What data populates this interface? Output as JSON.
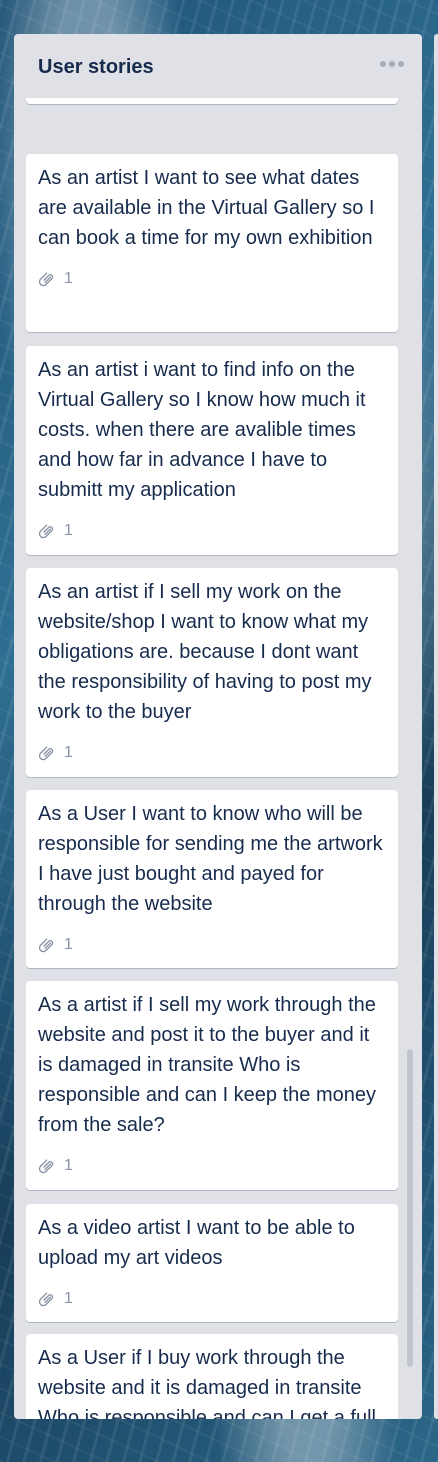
{
  "list": {
    "title": "User stories",
    "more_icon": "more-horizontal-icon"
  },
  "cards": [
    {
      "text": "As an artist I want to see what dates are available in the Virtual Gallery so I can book a time for my own exhibition",
      "attachments": "1"
    },
    {
      "text": "As an artist i want to find info on the Virtual Gallery so I know how much it costs. when there are avalible times and how far in advance I have to submitt my application",
      "attachments": "1"
    },
    {
      "text": "As an artist if I sell my work on the website/shop I want to know what my obligations are. because I dont want the responsibility of having to post my work to the buyer",
      "attachments": "1"
    },
    {
      "text": "As a User I want to know who will be responsible for sending me the artwork I have just bought and payed for through the website",
      "attachments": "1"
    },
    {
      "text": "As a artist if I sell my work through the website and post it to the buyer and it is damaged in transite Who is responsible and can I keep the money from the sale?",
      "attachments": "1"
    },
    {
      "text": "As a video artist I want to be able to upload my art videos",
      "attachments": "1"
    },
    {
      "text": "As a User if I buy work through the website and it is damaged in transite Who is responsible and can I get a full refund?"
    }
  ]
}
